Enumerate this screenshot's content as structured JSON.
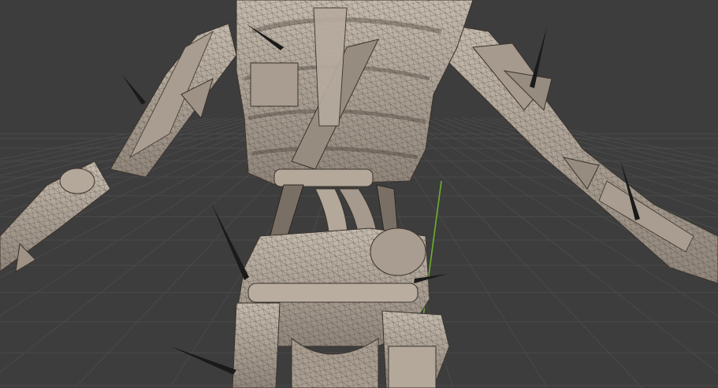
{
  "viewport": {
    "background": "#3d3d3d",
    "grid_color": "#4a4a4a",
    "y_axis_color": "#6fae2e",
    "mesh_fill": "#b3a89a",
    "mesh_shade": "#8d8276",
    "wire_color": "#3b332c",
    "spike_color": "#1a1a1a"
  },
  "object": {
    "name": "",
    "shading": "solid-wireframe"
  }
}
